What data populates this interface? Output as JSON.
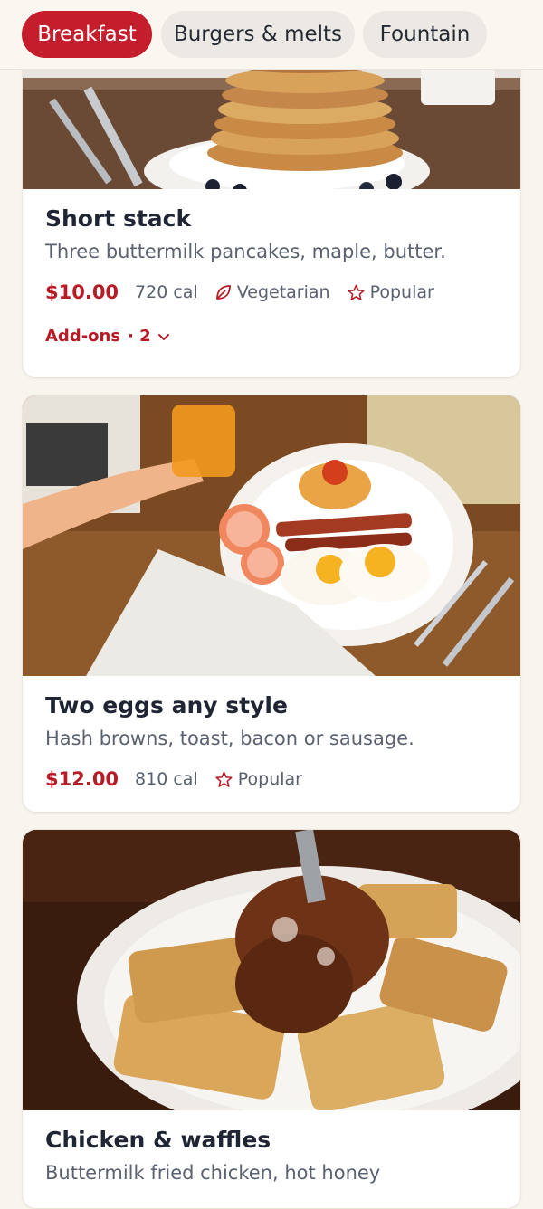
{
  "tabs": [
    {
      "label": "Breakfast",
      "active": true
    },
    {
      "label": "Burgers & melts",
      "active": false
    },
    {
      "label": "Fountain",
      "active": false
    }
  ],
  "items": [
    {
      "name": "Short stack",
      "description": "Three buttermilk pancakes, maple, butter.",
      "price": "$10.00",
      "calories": "720 cal",
      "tags": [
        "Vegetarian",
        "Popular"
      ],
      "addons_label": "Add-ons",
      "addons_count": "· 2",
      "image": "pancakes-photo"
    },
    {
      "name": "Two eggs any style",
      "description": "Hash browns, toast, bacon or sausage.",
      "price": "$12.00",
      "calories": "810 cal",
      "tags": [
        "Popular"
      ],
      "image": "eggs-breakfast-photo"
    },
    {
      "name": "Chicken & waffles",
      "description": "Buttermilk fried chicken, hot honey",
      "image": "chicken-waffles-photo"
    }
  ],
  "colors": {
    "accent": "#c41d2b",
    "price": "#b71c26",
    "background": "#f8f4ee"
  }
}
